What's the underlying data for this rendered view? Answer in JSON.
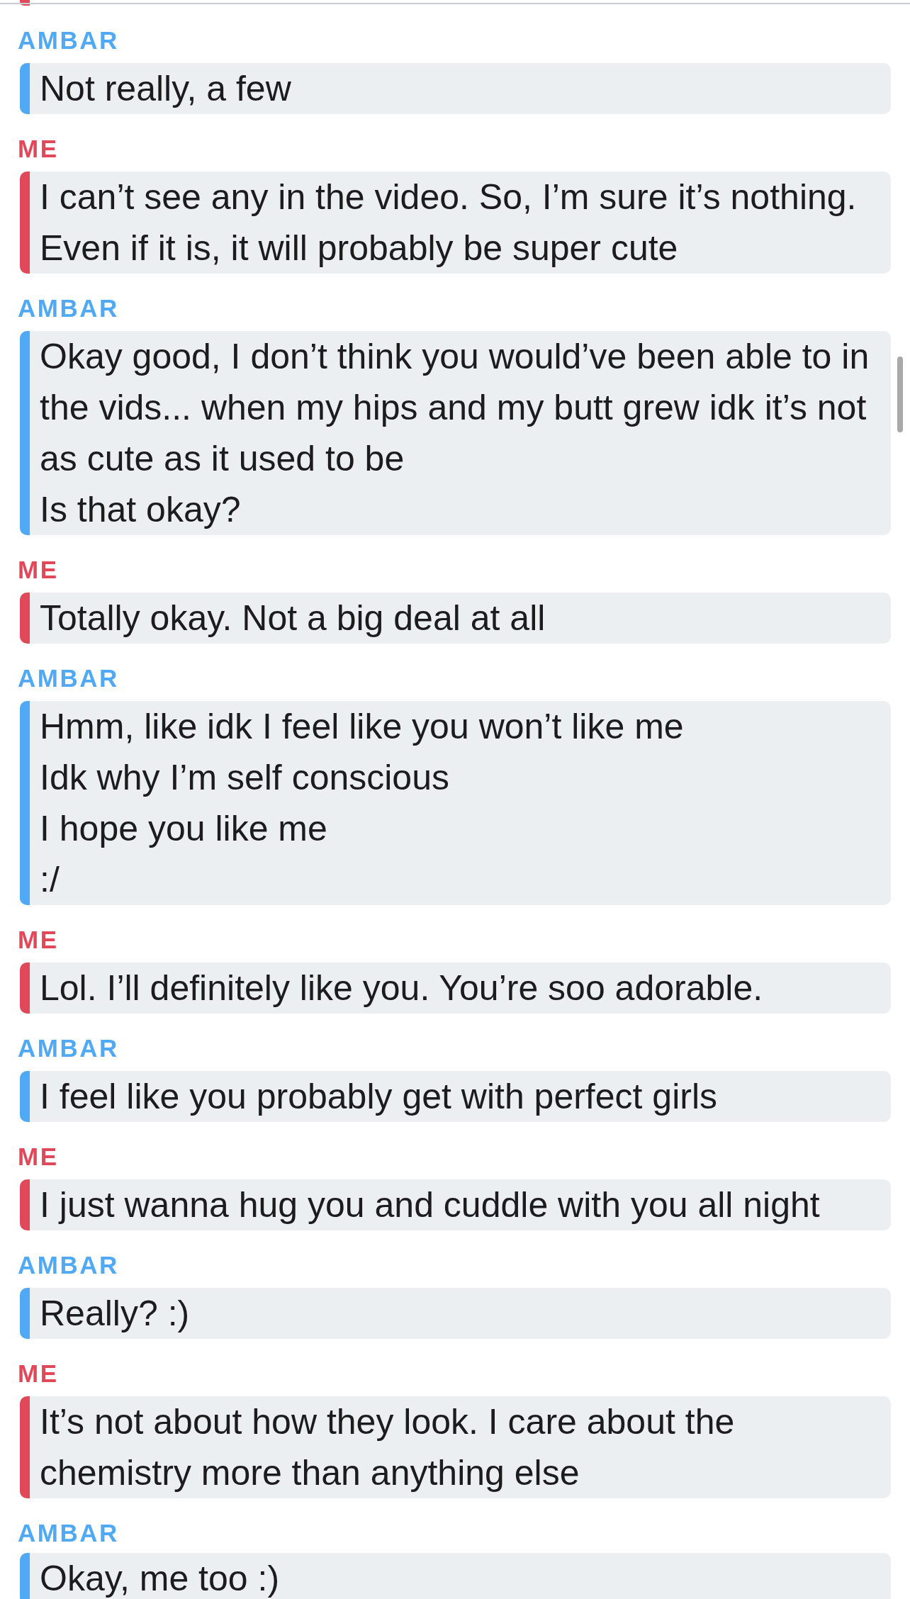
{
  "chat": {
    "top_fragment": {
      "color": "#e1495b"
    },
    "messages": [
      {
        "sender": "AMBAR",
        "color": "#4fa9f5",
        "texts": [
          "Not really, a few"
        ]
      },
      {
        "sender": "ME",
        "color": "#e1495b",
        "texts": [
          "I can’t see any in the video. So, I’m sure it’s nothing.",
          "Even if it is, it will probably be super cute"
        ]
      },
      {
        "sender": "AMBAR",
        "color": "#4fa9f5",
        "texts": [
          "Okay good, I don’t think you would’ve been able to in the vids... when my hips and my butt grew idk it’s not as cute as it used to be",
          "Is that okay?"
        ]
      },
      {
        "sender": "ME",
        "color": "#e1495b",
        "texts": [
          "Totally okay. Not a big deal at all"
        ]
      },
      {
        "sender": "AMBAR",
        "color": "#4fa9f5",
        "texts": [
          "Hmm, like idk I feel like you won’t like me",
          "Idk why I’m self conscious",
          "I hope you like me",
          ":/"
        ]
      },
      {
        "sender": "ME",
        "color": "#e1495b",
        "texts": [
          "Lol. I’ll definitely like you. You’re soo adorable."
        ]
      },
      {
        "sender": "AMBAR",
        "color": "#4fa9f5",
        "texts": [
          "I feel like you probably get with perfect girls"
        ]
      },
      {
        "sender": "ME",
        "color": "#e1495b",
        "texts": [
          "I just wanna hug you and cuddle with you all night"
        ]
      },
      {
        "sender": "AMBAR",
        "color": "#4fa9f5",
        "texts": [
          "Really? :)"
        ]
      },
      {
        "sender": "ME",
        "color": "#e1495b",
        "texts": [
          "It’s not about how they look. I care about the chemistry more than anything else"
        ]
      },
      {
        "sender": "AMBAR",
        "color": "#4fa9f5",
        "texts": [
          "Okay, me too :)"
        ]
      }
    ]
  }
}
